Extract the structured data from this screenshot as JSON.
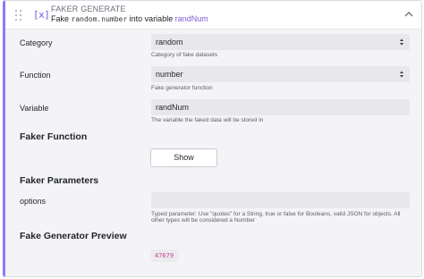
{
  "header": {
    "badge": "[x]",
    "title": "FAKER GENERATE",
    "desc_prefix": "Fake",
    "desc_code": "random.number",
    "desc_middle": "into variable",
    "desc_variable": "randNum"
  },
  "fields": {
    "category": {
      "label": "Category",
      "value": "random",
      "help": "Category of fake datasets"
    },
    "function": {
      "label": "Function",
      "value": "number",
      "help": "Fake generator function"
    },
    "variable": {
      "label": "Variable",
      "value": "randNum",
      "help": "The variable the faked data will be stored in"
    }
  },
  "faker_function": {
    "title": "Faker Function",
    "button": "Show"
  },
  "faker_parameters": {
    "title": "Faker Parameters",
    "options_label": "options",
    "options_value": "",
    "help_line1": "Typed parameter: Use \"quotes\" for a String, true or false for Booleans, valid JSON for objects. All",
    "help_line2": "other types will be considered a Number"
  },
  "preview": {
    "title": "Fake Generator Preview",
    "value": "47679"
  },
  "colors": {
    "accent": "#8b7cf6",
    "variable": "#7b5bd6",
    "preview_text": "#c0408b"
  }
}
